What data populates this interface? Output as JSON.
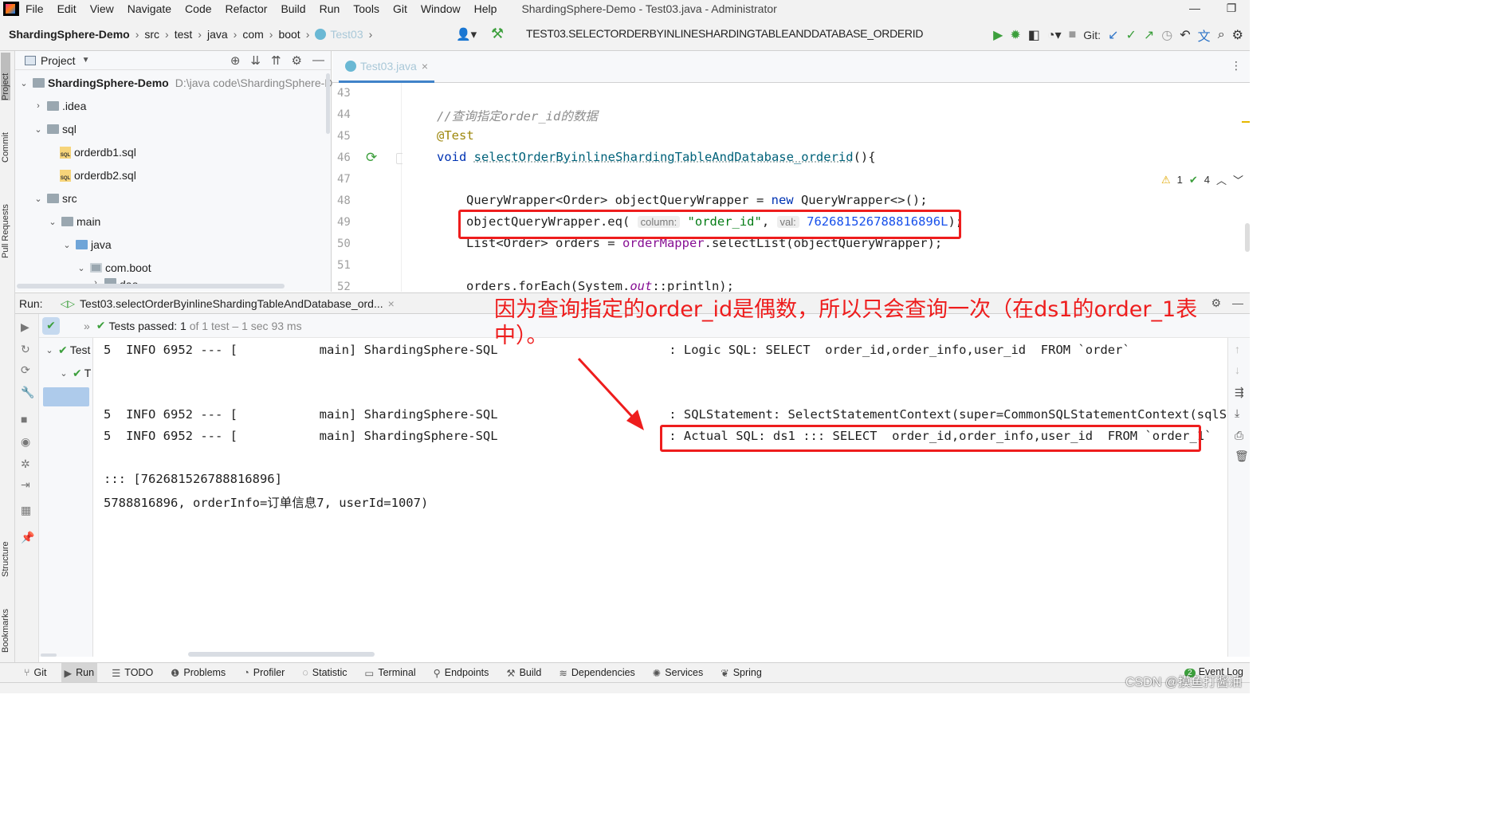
{
  "menu": {
    "items": [
      "File",
      "Edit",
      "View",
      "Navigate",
      "Code",
      "Refactor",
      "Build",
      "Run",
      "Tools",
      "Git",
      "Window",
      "Help"
    ],
    "title": "ShardingSphere-Demo - Test03.java - Administrator"
  },
  "nav": {
    "crumbs": [
      "ShardingSphere-Demo",
      "src",
      "test",
      "java",
      "com",
      "boot",
      "Test03"
    ],
    "run_config": "TEST03.SELECTORDERBYINLINESHARDINGTABLEANDDATABASE_ORDERID",
    "git_label": "Git:"
  },
  "left_strip": {
    "project": "Project",
    "commit": "Commit",
    "pull_requests": "Pull Requests",
    "structure": "Structure",
    "bookmarks": "Bookmarks"
  },
  "project": {
    "header": "Project",
    "tree": [
      {
        "label": "ShardingSphere-Demo",
        "path": "D:\\java code\\ShardingSphere-D"
      },
      {
        "label": ".idea"
      },
      {
        "label": "sql"
      },
      {
        "label": "orderdb1.sql"
      },
      {
        "label": "orderdb2.sql"
      },
      {
        "label": "src"
      },
      {
        "label": "main"
      },
      {
        "label": "java"
      },
      {
        "label": "com.boot"
      },
      {
        "label": "dao"
      }
    ]
  },
  "editor": {
    "tab": "Test03.java",
    "inspect_warn": "1",
    "inspect_ok": "4",
    "line_numbers": [
      "43",
      "44",
      "45",
      "46",
      "47",
      "48",
      "49",
      "50",
      "51",
      "52"
    ],
    "code": {
      "comment": "//查询指定order_id的数据",
      "annotation": "@Test",
      "sig_void": "void ",
      "sig_name": "selectOrderByinlineShardingTableAndDatabase_orderid",
      "sig_end": "(){",
      "l48_a": "QueryWrapper<Order> objectQueryWrapper = ",
      "l48_new": "new",
      "l48_b": " QueryWrapper<>();",
      "l49_a": "objectQueryWrapper.eq(",
      "l49_hint1": "column:",
      "l49_str": "\"order_id\"",
      "l49_comma": ",",
      "l49_hint2": "val:",
      "l49_num": "762681526788816896L",
      "l49_end": ");",
      "l50_a": "List<Order> orders = ",
      "l50_fld": "orderMapper",
      "l50_b": ".selectList(objectQueryWrapper);",
      "l52_a": "orders.forEach(System.",
      "l52_out": "out",
      "l52_b": "::println);"
    }
  },
  "run": {
    "label": "Run:",
    "tab": "Test03.selectOrderByinlineShardingTableAndDatabase_ord...",
    "status_prefix": "Tests passed:",
    "status_count": "1",
    "status_of": "of 1 test",
    "status_time": "– 1 sec 93 ms",
    "tree": [
      "Test",
      "T"
    ],
    "console": [
      "5  INFO 6952 --- [           main] ShardingSphere-SQL                       : Logic SQL: SELECT  order_id,order_info,user_id  FROM `order`",
      "",
      "",
      "5  INFO 6952 --- [           main] ShardingSphere-SQL                       : SQLStatement: SelectStatementContext(super=CommonSQLStatementContext(sqlStat",
      "5  INFO 6952 --- [           main] ShardingSphere-SQL                       : Actual SQL: ds1 ::: SELECT  order_id,order_info,user_id  FROM `order_1`",
      "",
      "::: [762681526788816896]",
      "5788816896, orderInfo=订单信息7, userId=1007)"
    ],
    "annotation": "因为查询指定的order_id是偶数，所以只会查询一次（在ds1的order_1表中）。"
  },
  "bottom_bar": {
    "items": [
      "Git",
      "Run",
      "TODO",
      "Problems",
      "Profiler",
      "Statistic",
      "Terminal",
      "Endpoints",
      "Build",
      "Dependencies",
      "Services",
      "Spring"
    ],
    "event_log": "Event Log",
    "event_count": "2"
  },
  "watermark": "CSDN @摸鱼打酱油",
  "colors": {
    "annotation_red": "#ee1d1d",
    "keyword": "#0033b3",
    "string": "#067d17",
    "number": "#1750eb",
    "pass_green": "#3c9f3c"
  }
}
